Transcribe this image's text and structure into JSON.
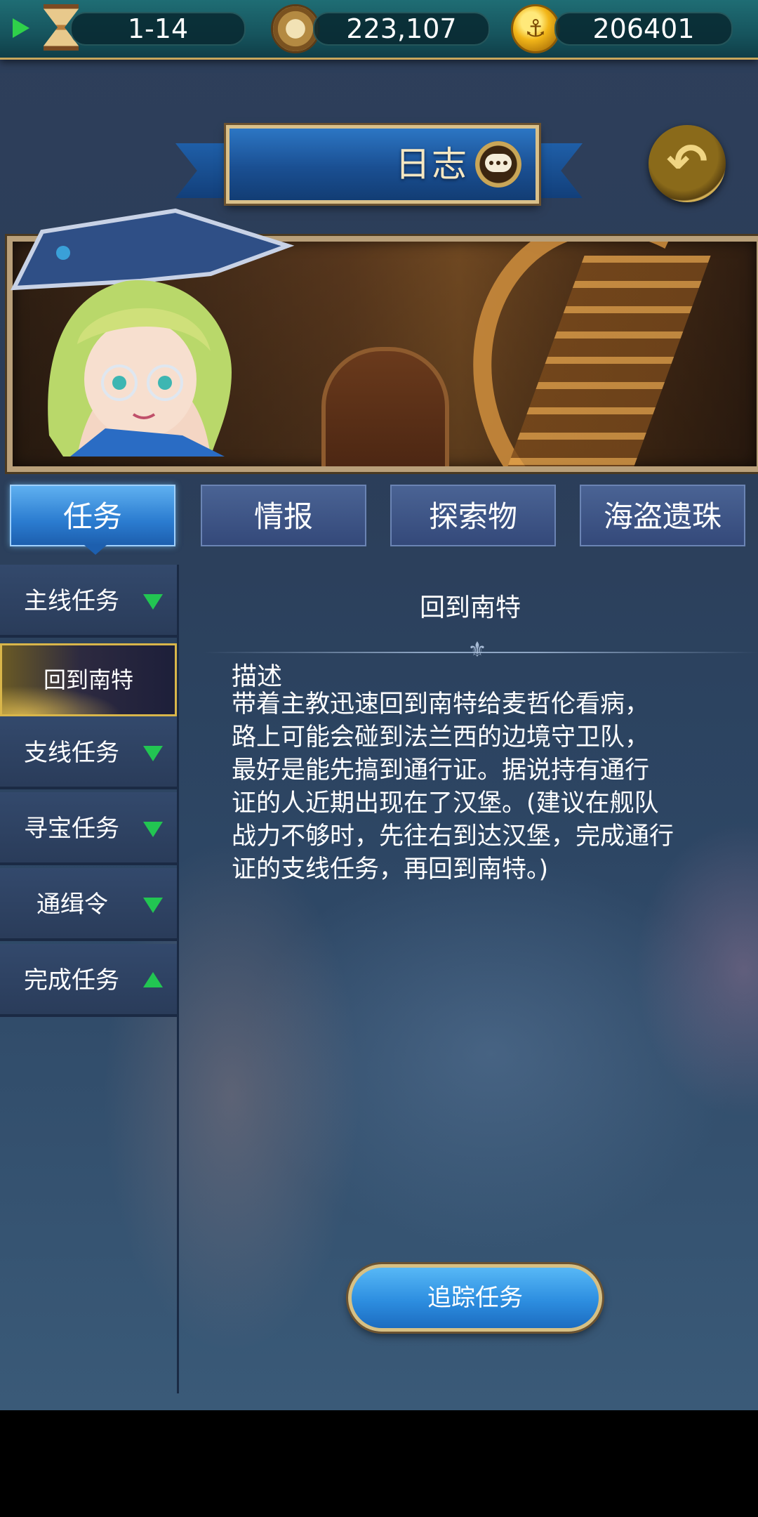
{
  "topbar": {
    "stage": "1-14",
    "compass_value": "223,107",
    "gold_value": "206401",
    "icons": [
      "play-icon",
      "hourglass-icon",
      "compass-icon",
      "gold-coin-icon"
    ]
  },
  "header": {
    "title": "日志"
  },
  "tabs": [
    {
      "label": "任务",
      "active": true
    },
    {
      "label": "情报",
      "active": false
    },
    {
      "label": "探索物",
      "active": false
    },
    {
      "label": "海盗遗珠",
      "active": false
    }
  ],
  "sidebar": {
    "items": [
      {
        "label": "主线任务",
        "arrow": "down"
      },
      {
        "label": "回到南特",
        "selected": true
      },
      {
        "label": "支线任务",
        "arrow": "down"
      },
      {
        "label": "寻宝任务",
        "arrow": "down"
      },
      {
        "label": "通缉令",
        "arrow": "down"
      },
      {
        "label": "完成任务",
        "arrow": "up"
      }
    ]
  },
  "detail": {
    "title": "回到南特",
    "desc_label": "描述",
    "desc_lines": [
      "带着主教迅速回到南特给麦哲伦看病，",
      "路上可能会碰到法兰西的边境守卫队，",
      "最好是能先搞到通行证。据说持有通行",
      "证的人近期出现在了汉堡。(建议在舰队",
      "战力不够时，先往右到达汉堡，完成通行",
      "证的支线任务，再回到南特。)"
    ]
  },
  "track_button": "追踪任务",
  "colors": {
    "accent_blue": "#2d8ee0",
    "gold_border": "#d6c084",
    "arrow_green": "#22c552"
  }
}
